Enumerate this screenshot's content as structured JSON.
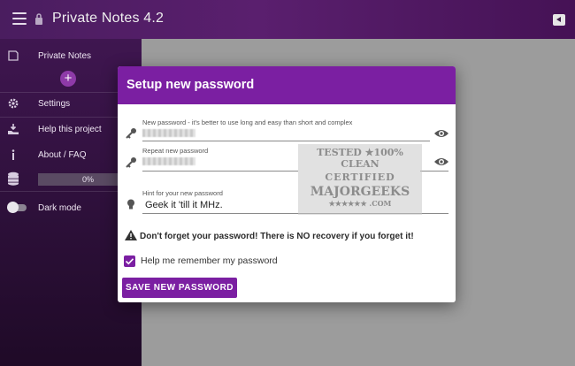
{
  "app": {
    "title": "Private Notes 4.2"
  },
  "sidebar": {
    "items": [
      {
        "label": "Private Notes",
        "icon": "note-icon"
      },
      {
        "label": "Settings",
        "icon": "gear-icon"
      },
      {
        "label": "Help this project",
        "icon": "donate-icon"
      },
      {
        "label": "About / FAQ",
        "icon": "info-icon"
      },
      {
        "label": "Dark mode",
        "icon": "toggle-icon"
      }
    ],
    "progress": {
      "text": "0%",
      "value": 0
    },
    "add_label": "+"
  },
  "dialog": {
    "title": "Setup new password",
    "fields": {
      "new_password": {
        "label": "New password - it's better to use long and easy than short and complex"
      },
      "repeat_password": {
        "label": "Repeat new password"
      },
      "hint": {
        "label": "Hint for your new password",
        "value": "Geek it 'till it MHz."
      }
    },
    "warning": "Don't forget your password! There is NO recovery if you forget it!",
    "remember_label": "Help me remember my password",
    "remember_checked": true,
    "save_label": "SAVE NEW PASSWORD"
  },
  "watermark": {
    "line1": "TESTED ★100% CLEAN",
    "line2": "CERTIFIED",
    "line3": "MAJORGEEKS",
    "line4": "★★★★★★ .COM"
  },
  "colors": {
    "accent": "#7b1fa2",
    "appbar": "#4a1d5f",
    "sidebar": "#2b0f37"
  }
}
